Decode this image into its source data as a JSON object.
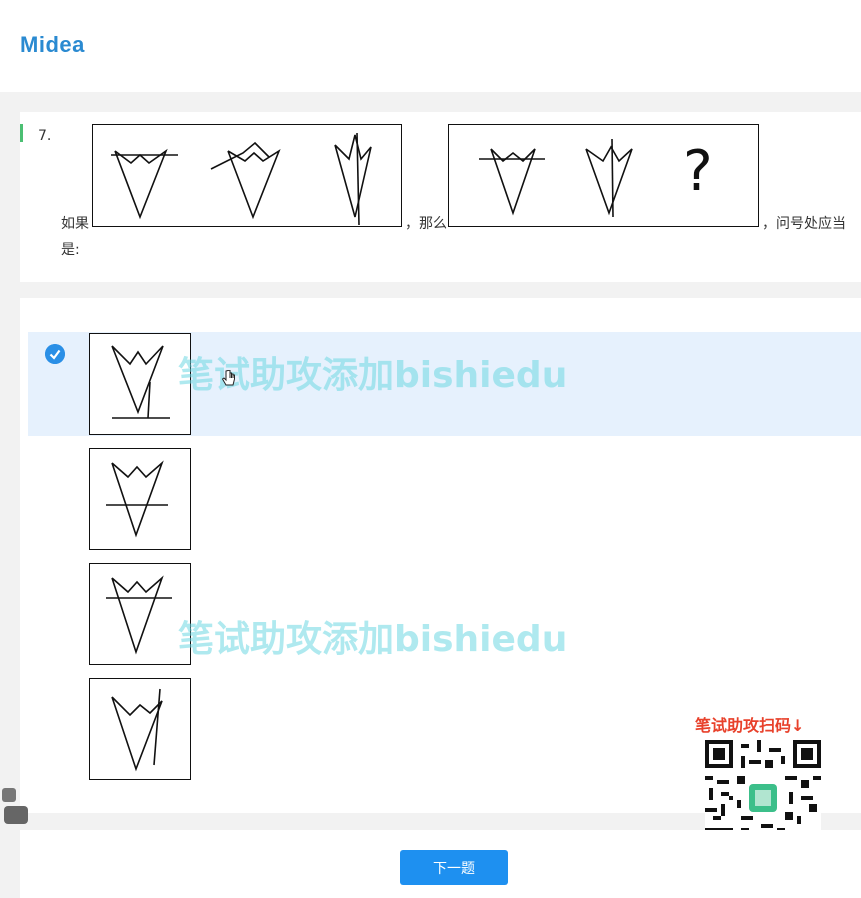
{
  "header": {
    "logo_text": "Midea"
  },
  "question": {
    "number": "7.",
    "prefix": "如果",
    "middle": "，那么",
    "suffix": "，问号处应当",
    "suffix_line2": "是:",
    "question_mark": "?"
  },
  "options": [
    {
      "name": "option-a",
      "selected": true
    },
    {
      "name": "option-b",
      "selected": false
    },
    {
      "name": "option-c",
      "selected": false
    },
    {
      "name": "option-d",
      "selected": false
    }
  ],
  "watermark": {
    "text": "笔试助攻添加bishiedu"
  },
  "promo": {
    "text": "笔试助攻扫码↓"
  },
  "footer": {
    "next_label": "下一题"
  },
  "colors": {
    "accent": "#1e90f0",
    "selected_bg": "#e6f1fd",
    "promo": "#e8412b",
    "brand": "#2a8ad1"
  },
  "icons": [
    "check-circle-icon",
    "hand-cursor-icon",
    "qr-code"
  ]
}
